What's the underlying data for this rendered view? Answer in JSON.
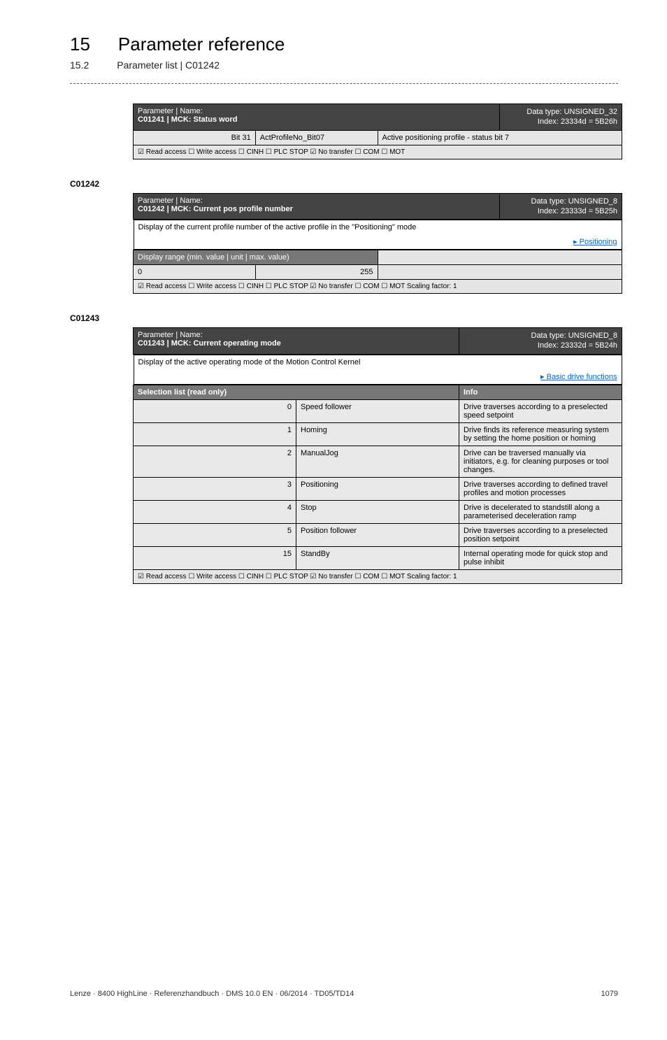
{
  "header": {
    "chapter_num": "15",
    "chapter_title": "Parameter reference",
    "section_num": "15.2",
    "section_title": "Parameter list | C01242"
  },
  "table1": {
    "hdr_label": "Parameter | Name:",
    "hdr_name": "C01241 | MCK: Status word",
    "hdr_type": "Data type: UNSIGNED_32",
    "hdr_index": "Index: 23334d = 5B26h",
    "bit": "Bit 31",
    "bitname": "ActProfileNo_Bit07",
    "bitdesc": "Active positioning profile - status bit 7",
    "access": "☑ Read access  ☐ Write access  ☐ CINH  ☐ PLC STOP  ☑ No transfer  ☐ COM  ☐ MOT"
  },
  "anchor2": "C01242",
  "table2": {
    "hdr_label": "Parameter | Name:",
    "hdr_name": "C01242 | MCK: Current pos profile number",
    "hdr_type": "Data type: UNSIGNED_8",
    "hdr_index": "Index: 23333d = 5B25h",
    "desc": "Display of the current profile number of the active profile in the \"Positioning\" mode",
    "link": "▸ Positioning",
    "range_label": "Display range (min. value | unit | max. value)",
    "min": "0",
    "unit": "",
    "max": "255",
    "access": "☑ Read access  ☐ Write access  ☐ CINH  ☐ PLC STOP  ☑ No transfer  ☐ COM  ☐ MOT    Scaling factor: 1"
  },
  "anchor3": "C01243",
  "table3": {
    "hdr_label": "Parameter | Name:",
    "hdr_name": "C01243 | MCK: Current operating mode",
    "hdr_type": "Data type: UNSIGNED_8",
    "hdr_index": "Index: 23332d = 5B24h",
    "desc": "Display of the active operating mode of the Motion Control Kernel",
    "link": "▸ Basic drive functions",
    "sel_label": "Selection list (read only)",
    "info_label": "Info",
    "rows": [
      {
        "n": "0",
        "name": "Speed follower",
        "info": "Drive traverses according to a preselected speed setpoint"
      },
      {
        "n": "1",
        "name": "Homing",
        "info": "Drive finds its reference measuring system by setting the home position or homing"
      },
      {
        "n": "2",
        "name": "ManualJog",
        "info": "Drive can be traversed manually via initiators, e.g. for cleaning purposes or tool changes."
      },
      {
        "n": "3",
        "name": "Positioning",
        "info": "Drive traverses according to defined travel profiles and motion processes"
      },
      {
        "n": "4",
        "name": "Stop",
        "info": "Drive is decelerated to standstill along a parameterised deceleration ramp"
      },
      {
        "n": "5",
        "name": "Position follower",
        "info": "Drive traverses according to a preselected position setpoint"
      },
      {
        "n": "15",
        "name": "StandBy",
        "info": "Internal operating mode for quick stop and pulse inhibit"
      }
    ],
    "access": "☑ Read access  ☐ Write access  ☐ CINH  ☐ PLC STOP  ☑ No transfer  ☐ COM  ☐ MOT    Scaling factor: 1"
  },
  "footer": {
    "left": "Lenze · 8400 HighLine · Referenzhandbuch · DMS 10.0 EN · 06/2014 · TD05/TD14",
    "right": "1079"
  }
}
